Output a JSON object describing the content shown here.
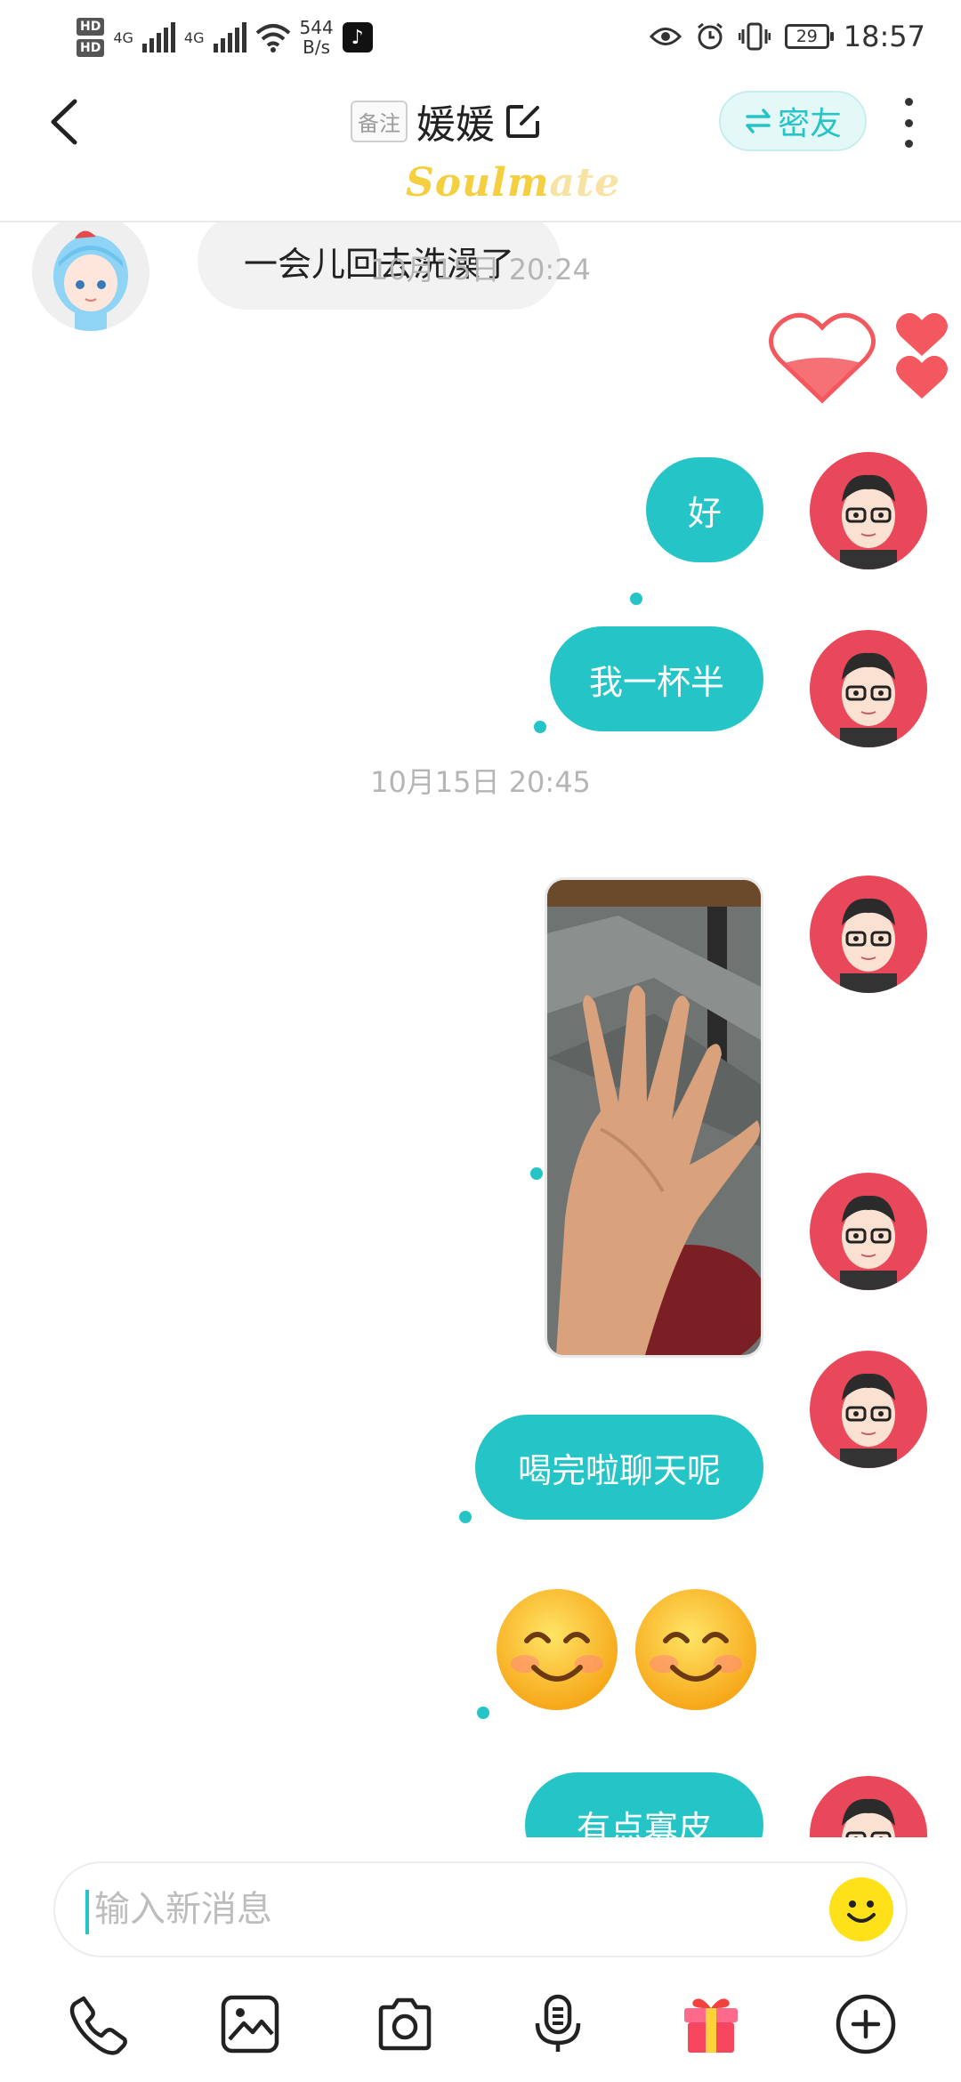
{
  "status_bar": {
    "hd1": "HD",
    "hd2": "HD",
    "net1": "4G",
    "net2": "4G",
    "speed_value": "544",
    "speed_unit": "B/s",
    "battery": "29",
    "time": "18:57"
  },
  "header": {
    "remark_tag": "备注",
    "contact_name": "媛媛",
    "friend_button": "密友",
    "brand_bold": "Soulm",
    "brand_fade": "ate"
  },
  "messages": {
    "m1": "一会儿回去洗澡了",
    "ts1": "10月15日 20:24",
    "m2": "好",
    "m3": "我一杯半",
    "ts2": "10月15日 20:45",
    "m4": "喝完啦聊天呢",
    "m5": "有点寡皮"
  },
  "input": {
    "placeholder": "输入新消息"
  },
  "colors": {
    "accent": "#25c5c7",
    "incoming_bubble": "#f2f2f2",
    "avatar_red": "#e8485a",
    "heart": "#f3585e"
  },
  "icons": [
    "back-arrow-icon",
    "edit-icon",
    "switch-arrows-icon",
    "more-vertical-icon",
    "heart-icon",
    "phone-icon",
    "image-icon",
    "camera-icon",
    "voice-icon",
    "gift-icon",
    "plus-circle-icon",
    "smiley-icon"
  ]
}
